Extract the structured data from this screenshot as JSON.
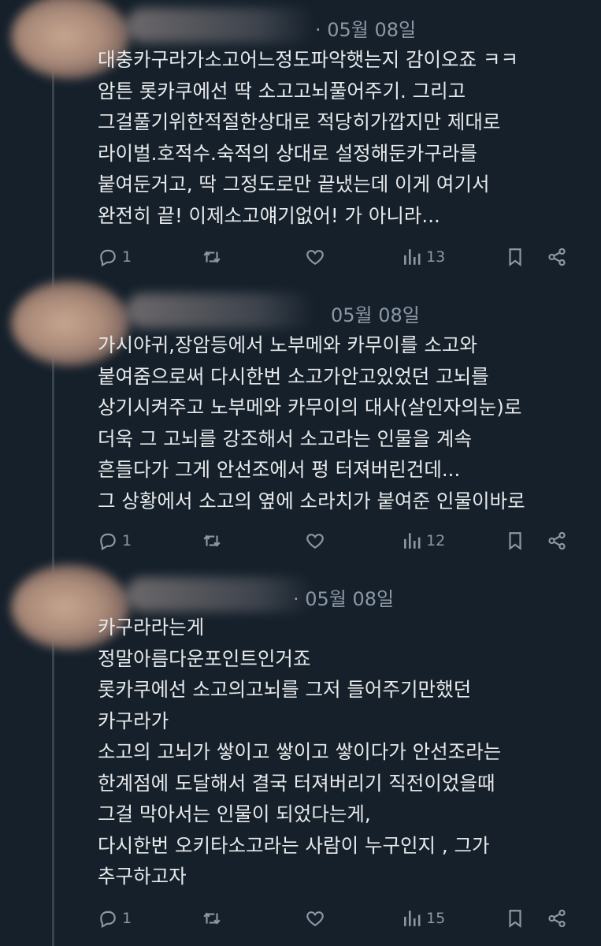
{
  "tweets": [
    {
      "date": "· 05월 08일",
      "lines": [
        "대충카구라가소고어느정도파악햇는지 감이오죠 ㅋㅋ",
        "암튼 롯카쿠에선 딱 소고고뇌풀어주기. 그리고",
        "그걸풀기위한적절한상대로 적당히가깝지만 제대로",
        "라이벌.호적수.숙적의 상대로 설정해둔카구라를",
        "붙여둔거고, 딱 그정도로만 끝냈는데 이게 여기서",
        "완전히 끝! 이제소고얘기없어! 가 아니라..."
      ],
      "reply_count": "1",
      "views": "13"
    },
    {
      "date": "05월 08일",
      "lines": [
        "가시야귀,장암등에서 노부메와 카무이를 소고와",
        "붙여줌으로써 다시한번 소고가안고있었던 고뇌를",
        "상기시켜주고 노부메와 카무이의 대사(살인자의눈)로",
        "더욱 그 고뇌를 강조해서 소고라는 인물을 계속",
        "흔들다가 그게 안선조에서 펑 터져버린건데...",
        "그 상황에서 소고의 옆에 소라치가 붙여준 인물이바로"
      ],
      "reply_count": "1",
      "views": "12"
    },
    {
      "date": "· 05월 08일",
      "lines": [
        "카구라라는게",
        "정말아름다운포인트인거죠",
        "롯카쿠에선 소고의고뇌를 그저 들어주기만했던",
        "카구라가",
        "소고의 고뇌가 쌓이고 쌓이고 쌓이다가 안선조라는",
        "한계점에 도달해서 결국 터져버리기 직전이었을때",
        "그걸 막아서는 인물이 되었다는게,",
        "다시한번 오키타소고라는 사람이 누구인지 , 그가",
        "추구하고자"
      ],
      "reply_count": "1",
      "views": "15"
    }
  ],
  "colors": {
    "background": "#15202b",
    "text": "#e7e9ea",
    "muted": "#8b98a5",
    "thread_line": "#38444d"
  }
}
